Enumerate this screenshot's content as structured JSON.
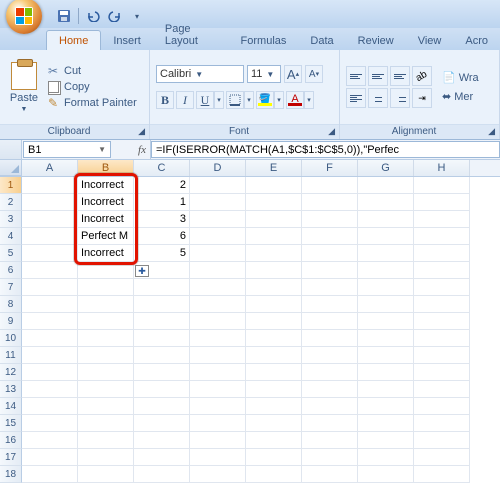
{
  "qat": {
    "save": "save-icon",
    "undo": "undo-icon",
    "redo": "redo-icon"
  },
  "tabs": {
    "home": "Home",
    "insert": "Insert",
    "pagelayout": "Page Layout",
    "formulas": "Formulas",
    "data": "Data",
    "review": "Review",
    "view": "View",
    "acrobat": "Acro"
  },
  "ribbon": {
    "paste": "Paste",
    "cut": "Cut",
    "copy": "Copy",
    "formatpainter": "Format Painter",
    "clipboard_label": "Clipboard",
    "font_name": "Calibri",
    "font_size": "11",
    "font_label": "Font",
    "alignment_label": "Alignment",
    "wrap": "Wra",
    "merge": "Mer"
  },
  "namebox": "B1",
  "formula": "=IF(ISERROR(MATCH(A1,$C$1:$C$5,0)),\"Perfec",
  "columns": [
    "A",
    "B",
    "C",
    "D",
    "E",
    "F",
    "G",
    "H"
  ],
  "rows": [
    "1",
    "2",
    "3",
    "4",
    "5",
    "6",
    "7",
    "8",
    "9",
    "10",
    "11",
    "12",
    "13",
    "14",
    "15",
    "16",
    "17",
    "18"
  ],
  "cells": {
    "b1": "Incorrect ",
    "c1": "2",
    "b2": "Incorrect ",
    "c2": "1",
    "b3": "Incorrect ",
    "c3": "3",
    "b4": "Perfect M",
    "c4": "6",
    "b5": "Incorrect ",
    "c5": "5"
  }
}
